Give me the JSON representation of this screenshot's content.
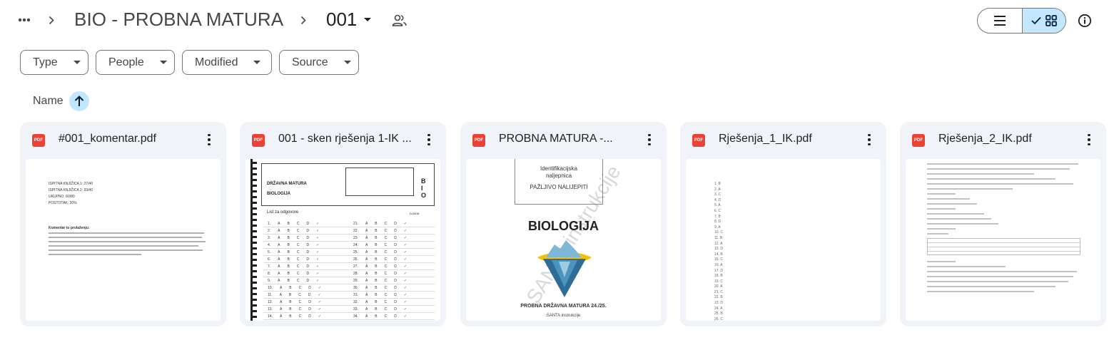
{
  "breadcrumb": {
    "parent": "BIO - PROBNA MATURA",
    "current": "001"
  },
  "icons": {
    "more": "more-horiz-icon",
    "separator": "chevron-right-icon",
    "share": "shared-people-icon",
    "list_view": "list-view-icon",
    "grid_view": "grid-view-icon",
    "check": "check-icon",
    "info": "info-icon",
    "sort": "arrow-up-icon",
    "file_type": "pdf-icon",
    "kebab": "more-vert-icon"
  },
  "filters": [
    {
      "label": "Type"
    },
    {
      "label": "People"
    },
    {
      "label": "Modified"
    },
    {
      "label": "Source"
    }
  ],
  "sort": {
    "label": "Name",
    "direction": "ascending"
  },
  "view_mode": "grid",
  "files": [
    {
      "name": "#001_komentar.pdf",
      "type_badge": "PDF"
    },
    {
      "name": "001 - sken rješenja 1-IK ...",
      "type_badge": "PDF"
    },
    {
      "name": "PROBNA MATURA -...",
      "type_badge": "PDF"
    },
    {
      "name": "Rješenja_1_IK.pdf",
      "type_badge": "PDF"
    },
    {
      "name": "Rješenja_2_IK.pdf",
      "type_badge": "PDF"
    }
  ],
  "thumbnails": {
    "komentar": {
      "lines": [
        "ISPITNA KNJIŽICA 1: 27/40",
        "ISPITNA KNJIŽICA 2: 33/40",
        "UKUPNO: 60/80",
        "POSTOTAK: 30%"
      ],
      "heading": "Komentar to prolaženju:"
    },
    "sken": {
      "exam": "DRŽAVNA MATURA",
      "subject": "BIOLOGIJA",
      "sheet": "List za odgovore",
      "code": "D-BIO8",
      "side": "B I O"
    },
    "probna": {
      "label_line1": "Identifikacijska",
      "label_line2": "naljepnica",
      "label_line3": "PAŽLJIVO NALIJEPITI",
      "title": "BIOLOGIJA",
      "footer1": "PROBNA DRŽAVNA MATURA 24./25.",
      "footer2": "SANTA instrukcije",
      "watermark": "SANTA instrukcije"
    },
    "rjesenja1": {
      "answers": [
        "1. B",
        "2. A",
        "3. C",
        "4. D",
        "5. A",
        "6. C",
        "7. B",
        "8. D",
        "9. A",
        "10. C",
        "11. B",
        "12. A",
        "13. D",
        "14. B",
        "15. C",
        "16. A",
        "17. D",
        "18. B",
        "19. C",
        "20. A",
        "21. C",
        "22. B",
        "23. D",
        "24. A",
        "25. B",
        "26. C",
        "27. D",
        "28. A",
        "29. B",
        "30. C",
        "31. D",
        "32. A"
      ]
    }
  }
}
